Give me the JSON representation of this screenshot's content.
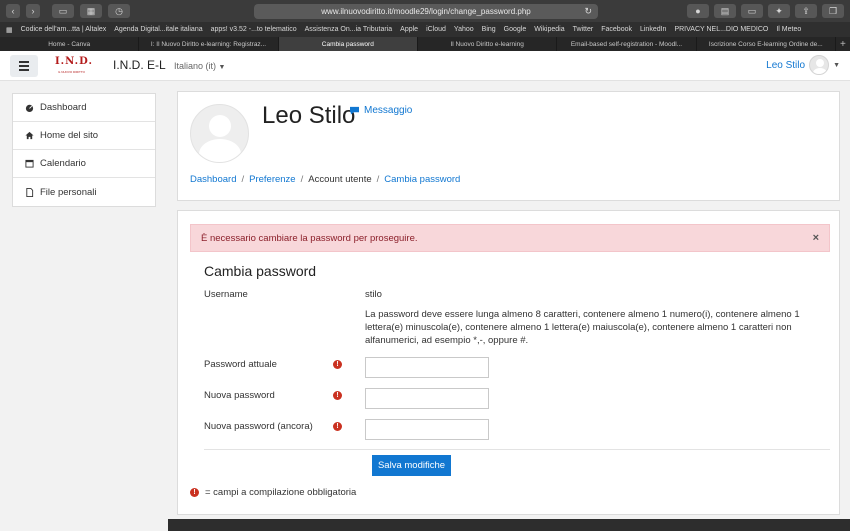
{
  "browser": {
    "url": "www.ilnuovodiritto.it/moodle29/login/change_password.php",
    "bookmarks": [
      "Codice dell'am...tta | Altalex",
      "Agenda Digital...itale italiana",
      "apps! v3.52 -...to telematico",
      "Assistenza On...ia Tributaria",
      "Apple",
      "iCloud",
      "Yahoo",
      "Bing",
      "Google",
      "Wikipedia",
      "Twitter",
      "Facebook",
      "LinkedIn",
      "PRIVACY NEL...DIO MEDICO",
      "Il Meteo"
    ],
    "tabs": [
      {
        "label": "Home - Canva",
        "active": false
      },
      {
        "label": "I: Il Nuovo Diritto e-learning: Registraz...",
        "active": false
      },
      {
        "label": "Cambia password",
        "active": true
      },
      {
        "label": "Il Nuovo Diritto e-learning",
        "active": false
      },
      {
        "label": "Email-based self-registration - Moodl...",
        "active": false
      },
      {
        "label": "Iscrizione Corso E-learning Ordine de...",
        "active": false
      }
    ]
  },
  "navbar": {
    "logo_text": "I.N.D.",
    "logo_sub": "IL NUOVO DIRITTO",
    "site_name": "I.N.D. E-L",
    "language": "Italiano (it)",
    "user_name": "Leo Stilo"
  },
  "sidebar": {
    "items": [
      {
        "label": "Dashboard",
        "icon": "dashboard-icon"
      },
      {
        "label": "Home del sito",
        "icon": "home-icon"
      },
      {
        "label": "Calendario",
        "icon": "calendar-icon"
      },
      {
        "label": "File personali",
        "icon": "file-icon"
      }
    ]
  },
  "profile": {
    "full_name": "Leo Stilo",
    "message_label": "Messaggio"
  },
  "breadcrumb": {
    "items": [
      "Dashboard",
      "Preferenze",
      "Account utente",
      "Cambia password"
    ]
  },
  "alert": {
    "text": "È necessario cambiare la password per proseguire.",
    "close": "×"
  },
  "form": {
    "title": "Cambia password",
    "username_label": "Username",
    "username_value": "stilo",
    "rules": "La password deve essere lunga almeno 8 caratteri, contenere almeno 1 numero(i), contenere almeno 1 lettera(e) minuscola(e), contenere almeno 1 lettera(e) maiuscola(e), contenere almeno 1 caratteri non alfanumerici, ad esempio *,-, oppure #.",
    "current_password_label": "Password attuale",
    "new_password_label": "Nuova password",
    "new_password_again_label": "Nuova password (ancora)",
    "save_label": "Salva modifiche",
    "required_legend": "= campi a compilazione obbligatoria",
    "required_mark": "!"
  },
  "colors": {
    "link": "#1177d1",
    "alert_bg": "#f8d7da",
    "required": "#ca3120",
    "button": "#1177d1"
  }
}
